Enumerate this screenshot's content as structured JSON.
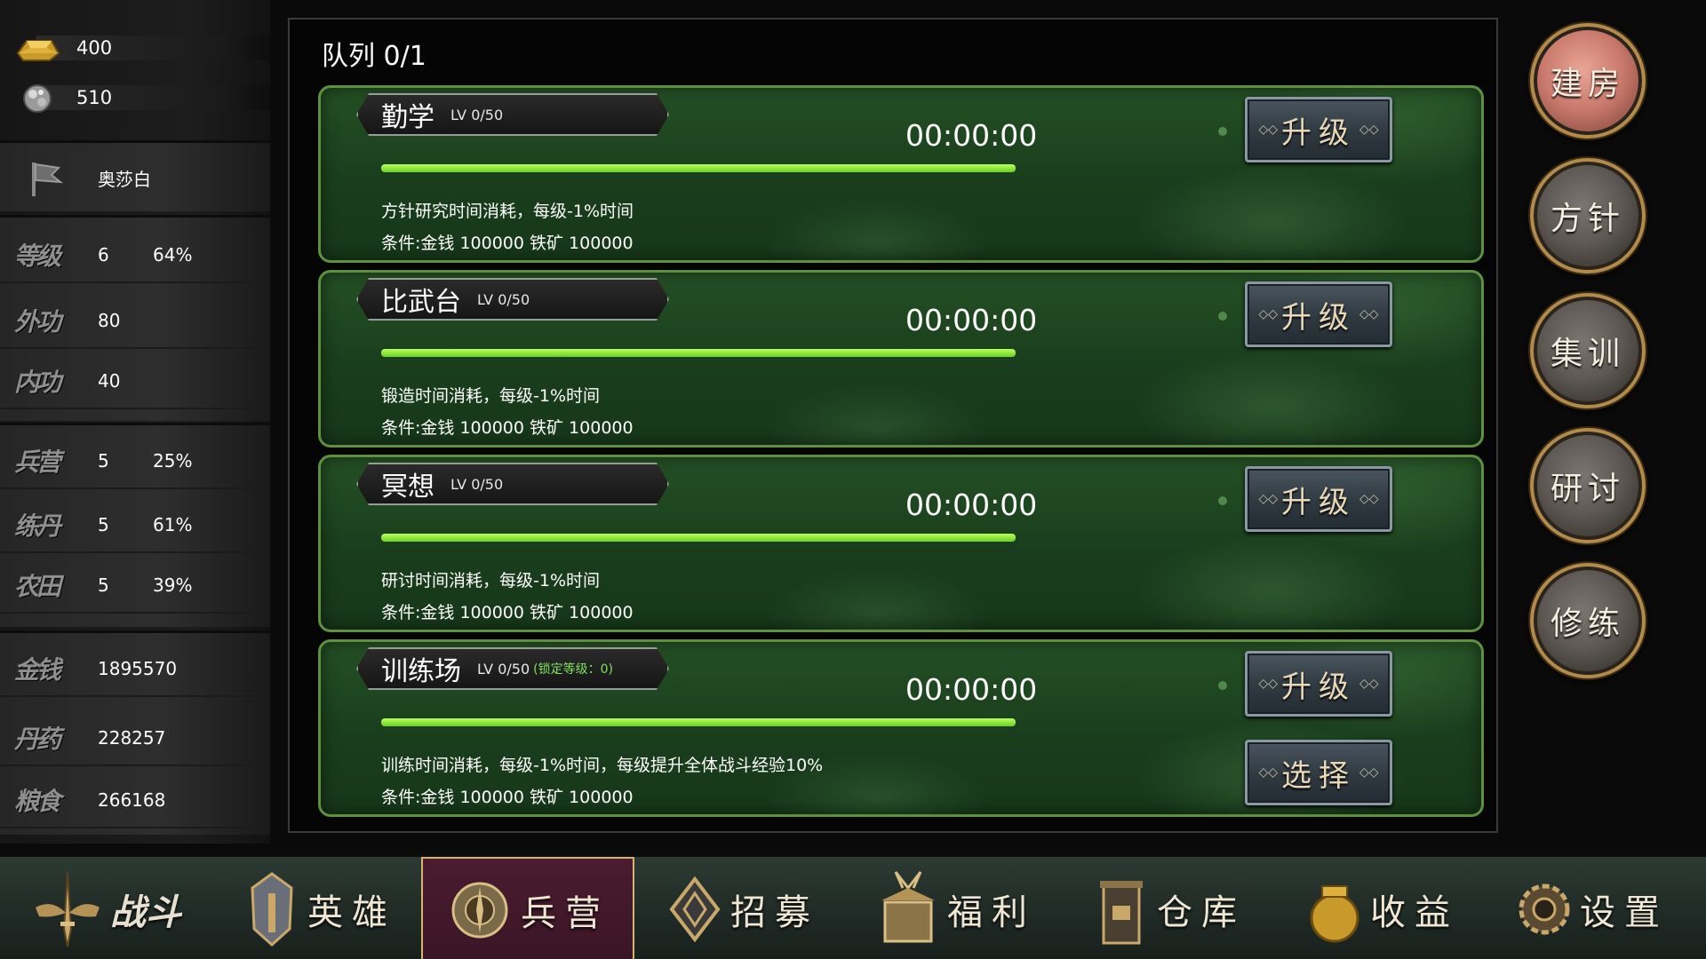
{
  "resources": [
    {
      "icon": "gold-ingot-icon",
      "value": "400"
    },
    {
      "icon": "silver-ore-icon",
      "value": "510"
    }
  ],
  "player": {
    "flag_icon": "flag-icon",
    "name": "奥莎白"
  },
  "stats_group1": [
    {
      "label": "等级",
      "value": "6",
      "percent": "64%"
    },
    {
      "label": "外功",
      "value": "80",
      "percent": ""
    },
    {
      "label": "内功",
      "value": "40",
      "percent": ""
    }
  ],
  "stats_group2": [
    {
      "label": "兵营",
      "value": "5",
      "percent": "25%"
    },
    {
      "label": "练丹",
      "value": "5",
      "percent": "61%"
    },
    {
      "label": "农田",
      "value": "5",
      "percent": "39%"
    }
  ],
  "stats_group3": [
    {
      "label": "金钱",
      "value": "1895570"
    },
    {
      "label": "丹药",
      "value": "228257"
    },
    {
      "label": "粮食",
      "value": "266168"
    }
  ],
  "main": {
    "queue": "队列 0/1",
    "cards": [
      {
        "name": "勤学",
        "level": "LV 0/50",
        "lock": "",
        "timer": "00:00:00",
        "progress": 1.0,
        "desc": "方针研究时间消耗，每级-1%时间",
        "cond": "条件:金钱 100000 铁矿 100000",
        "buttons": [
          "升级"
        ]
      },
      {
        "name": "比武台",
        "level": "LV 0/50",
        "lock": "",
        "timer": "00:00:00",
        "progress": 1.0,
        "desc": "锻造时间消耗，每级-1%时间",
        "cond": "条件:金钱 100000 铁矿 100000",
        "buttons": [
          "升级"
        ]
      },
      {
        "name": "冥想",
        "level": "LV 0/50",
        "lock": "",
        "timer": "00:00:00",
        "progress": 1.0,
        "desc": "研讨时间消耗，每级-1%时间",
        "cond": "条件:金钱 100000 铁矿 100000",
        "buttons": [
          "升级"
        ]
      },
      {
        "name": "训练场",
        "level": "LV 0/50",
        "lock": "(锁定等级：0)",
        "timer": "00:00:00",
        "progress": 1.0,
        "desc": "训练时间消耗，每级-1%时间，每级提升全体战斗经验10%",
        "cond": "条件:金钱 100000 铁矿 100000",
        "buttons": [
          "升级",
          "选择"
        ]
      }
    ]
  },
  "right_buttons": [
    "建房",
    "方针",
    "集训",
    "研讨",
    "修练"
  ],
  "right_active": 0,
  "bottom_nav": [
    {
      "label": "战斗",
      "icon": "sword-wings-icon"
    },
    {
      "label": "英雄",
      "icon": "helmet-icon"
    },
    {
      "label": "兵营",
      "icon": "barracks-emblem-icon"
    },
    {
      "label": "招募",
      "icon": "diamond-banner-icon"
    },
    {
      "label": "福利",
      "icon": "gift-box-icon"
    },
    {
      "label": "仓库",
      "icon": "warehouse-icon"
    },
    {
      "label": "收益",
      "icon": "treasure-pot-icon"
    },
    {
      "label": "设置",
      "icon": "gear-icon"
    }
  ],
  "bottom_active": 2,
  "colors": {
    "accent_green": "#6ccf2a",
    "card_border": "#5f8f40",
    "lock_text": "#7fe05a",
    "active_nav": "#4a1c30"
  }
}
